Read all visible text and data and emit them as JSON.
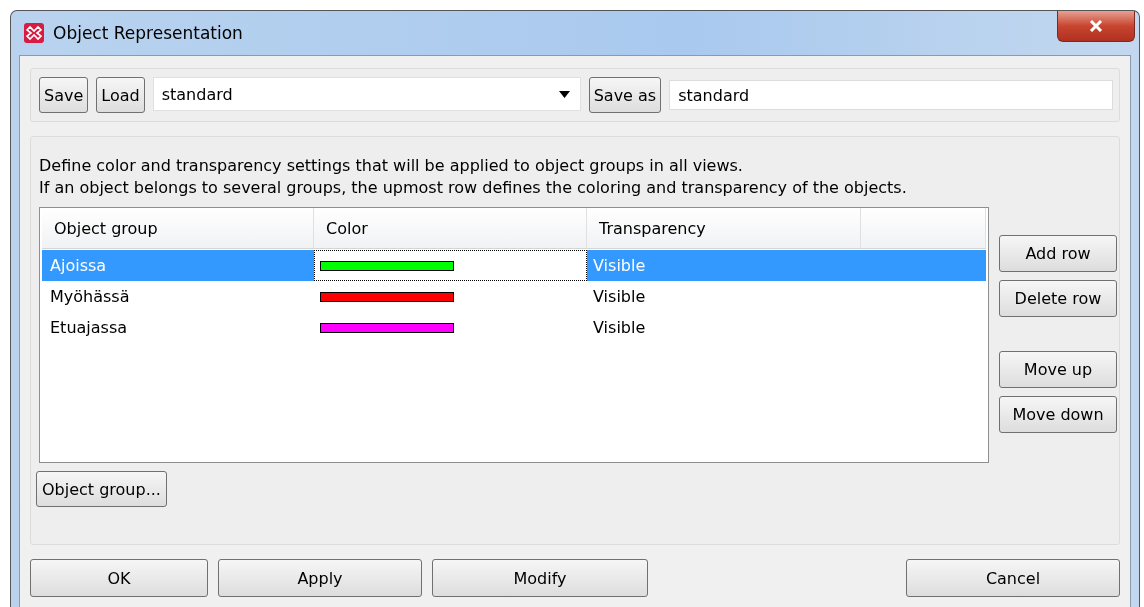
{
  "window": {
    "title": "Object Representation"
  },
  "toolbar": {
    "buttons": [
      "Save",
      "Load"
    ],
    "profile_value": "standard",
    "save_as_button": "Save as",
    "save_as_value": "standard"
  },
  "description": [
    "Define color and transparency settings that will be applied to object groups in all views.",
    "If an object belongs to several groups, the upmost row defines the coloring and transparency of the objects."
  ],
  "table": {
    "columns": [
      "Object group",
      "Color",
      "Transparency"
    ],
    "rows": [
      {
        "group": "Ajoissa",
        "color": "#00ff00",
        "transparency": "Visible",
        "selected": true
      },
      {
        "group": "Myöhässä",
        "color": "#ff0000",
        "transparency": "Visible",
        "selected": false
      },
      {
        "group": "Etuajassa",
        "color": "#ff00ff",
        "transparency": "Visible",
        "selected": false
      }
    ]
  },
  "row_buttons": [
    "Add row",
    "Delete row"
  ],
  "move_buttons": [
    "Move up",
    "Move down"
  ],
  "object_group_button": "Object group...",
  "footer_buttons": [
    "OK",
    "Apply",
    "Modify",
    "Cancel"
  ]
}
